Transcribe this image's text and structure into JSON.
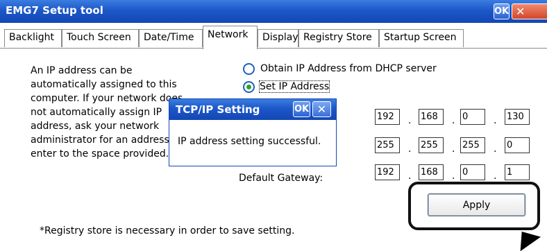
{
  "window": {
    "title": "EMG7 Setup tool",
    "ok_label": "OK",
    "close_label": "✕"
  },
  "tabs": [
    "Backlight",
    "Touch Screen",
    "Date/Time",
    "Network",
    "Display",
    "Registry Store",
    "Startup Screen"
  ],
  "active_tab": "Network",
  "description_lines": [
    "An IP address can be",
    "automatically assigned to this",
    "computer. If your network does",
    "not automatically assign IP",
    "address, ask your network",
    "administrator for an address and",
    "enter to the space provided."
  ],
  "radios": {
    "dhcp": {
      "label": "Obtain IP Address from DHCP server",
      "checked": false
    },
    "static": {
      "label": "Set IP Address",
      "checked": true
    }
  },
  "ip_address": [
    "192",
    "168",
    "0",
    "130"
  ],
  "subnet_mask": [
    "255",
    "255",
    "255",
    "0"
  ],
  "gateway": {
    "label": "Default Gateway:",
    "values": [
      "192",
      "168",
      "0",
      "1"
    ]
  },
  "apply_label": "Apply",
  "note": "*Registry store is necessary in order to save setting.",
  "dialog": {
    "title": "TCP/IP Setting",
    "ok_label": "OK",
    "close_label": "✕",
    "message": "IP address setting successful."
  },
  "colors": {
    "titlebar": "#1c57c9",
    "radio_selected": "#2aa32a",
    "highlight_frame": "#111111"
  }
}
